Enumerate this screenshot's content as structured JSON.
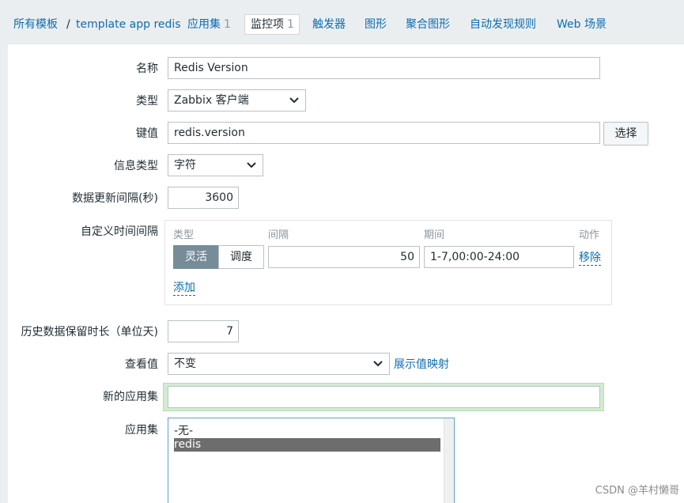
{
  "breadcrumb": {
    "all_templates": "所有模板",
    "separator": "/",
    "template": "template app redis"
  },
  "tabs": [
    {
      "label": "应用集",
      "count": "1"
    },
    {
      "label": "监控项",
      "count": "1"
    },
    {
      "label": "触发器"
    },
    {
      "label": "图形"
    },
    {
      "label": "聚合图形"
    },
    {
      "label": "自动发现规则"
    },
    {
      "label": "Web 场景"
    }
  ],
  "form": {
    "name_label": "名称",
    "name_value": "Redis Version",
    "type_label": "类型",
    "type_value": "Zabbix 客户端",
    "key_label": "键值",
    "key_value": "redis.version",
    "select_button": "选择",
    "info_type_label": "信息类型",
    "info_type_value": "字符",
    "update_interval_label": "数据更新间隔(秒)",
    "update_interval_value": "3600",
    "custom_intervals_label": "自定义时间间隔",
    "custom_intervals": {
      "col_type": "类型",
      "col_interval": "间隔",
      "col_period": "期间",
      "col_action": "动作",
      "seg_flexible": "灵活",
      "seg_scheduling": "调度",
      "interval_value": "50",
      "period_value": "1-7,00:00-24:00",
      "remove": "移除",
      "add": "添加"
    },
    "history_label": "历史数据保留时长（单位天)",
    "history_value": "7",
    "show_value_label": "查看值",
    "show_value_value": "不变",
    "show_value_mapping_link": "展示值映射",
    "new_application_label": "新的应用集",
    "new_application_value": "",
    "applications_label": "应用集",
    "applications_options": [
      "-无-",
      "redis"
    ],
    "applications_selected": "redis"
  },
  "watermark": "CSDN @羊村懒哥",
  "colors": {
    "link": "#0b6db3",
    "segment_active": "#768d99",
    "highlight_green": "#d3ebd1",
    "selected_option": "#6d6d6d"
  }
}
